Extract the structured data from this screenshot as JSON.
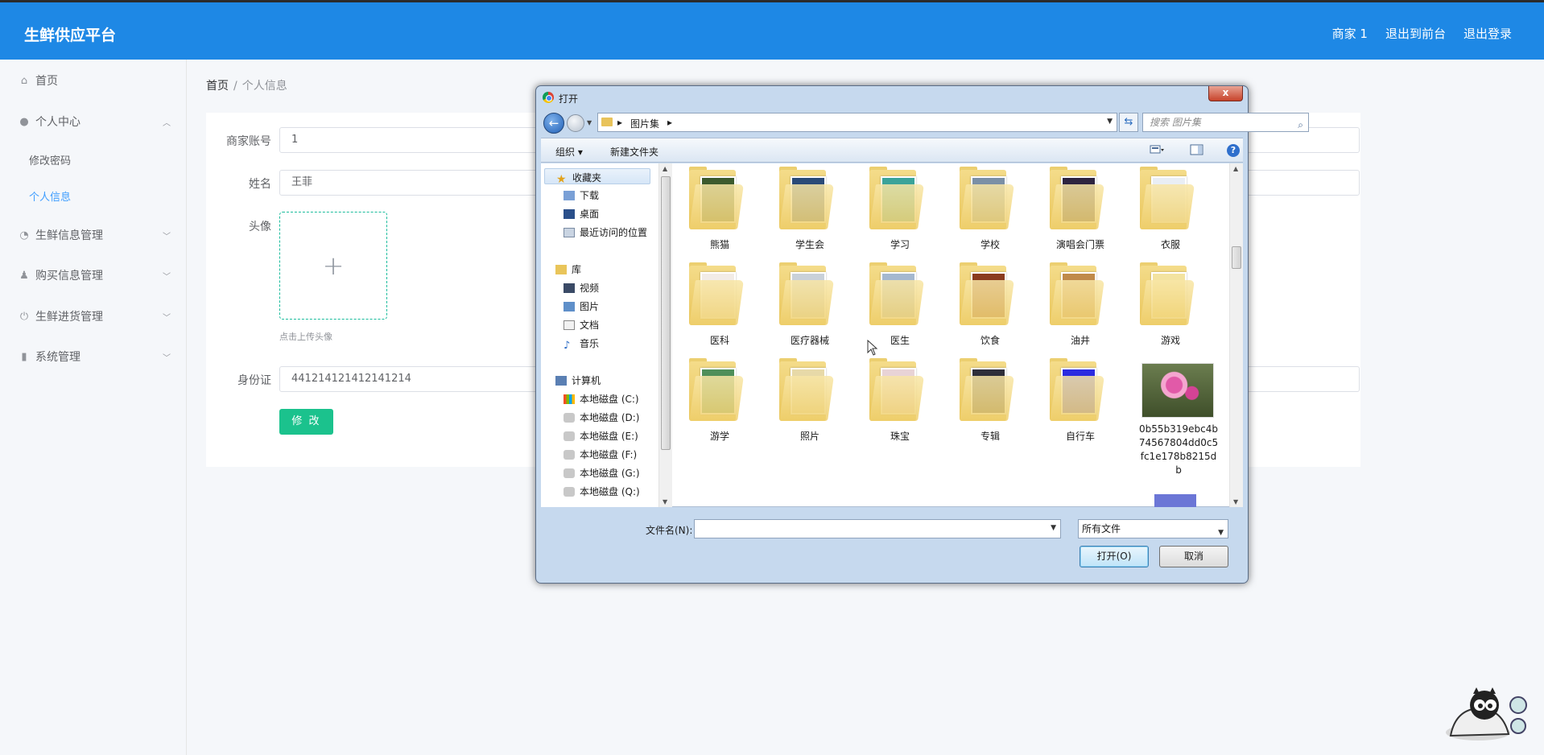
{
  "header": {
    "brand": "生鲜供应平台",
    "nav": [
      "商家 1",
      "退出到前台",
      "退出登录"
    ]
  },
  "sidebar": {
    "home": "首页",
    "personal_center": "个人中心",
    "change_password": "修改密码",
    "personal_info": "个人信息",
    "fresh_info": "生鲜信息管理",
    "purchase_info": "购买信息管理",
    "stock_in": "生鲜进货管理",
    "system": "系统管理"
  },
  "breadcrumb": {
    "home": "首页",
    "separator": "/",
    "current": "个人信息"
  },
  "form": {
    "account_label": "商家账号",
    "account_value": "1",
    "name_label": "姓名",
    "name_value": "王菲",
    "avatar_label": "头像",
    "avatar_plus": "+",
    "upload_tip": "点击上传头像",
    "id_label": "身份证",
    "id_value": "441214121412141214",
    "submit_label": "修 改"
  },
  "dialog": {
    "title": "打开",
    "close": "x",
    "back_arrow": "←",
    "address_root": "▸",
    "address_folder": "图片集",
    "address_arrow": "▸",
    "search_placeholder": "搜索 图片集",
    "toolbar": {
      "organize": "组织 ▾",
      "new_folder": "新建文件夹",
      "help": "?"
    },
    "nav_tree": {
      "favorites": "收藏夹",
      "downloads": "下载",
      "desktop": "桌面",
      "recent": "最近访问的位置",
      "library": "库",
      "videos": "视频",
      "pictures": "图片",
      "documents": "文档",
      "music": "音乐",
      "computer": "计算机",
      "drives": [
        "本地磁盘 (C:)",
        "本地磁盘 (D:)",
        "本地磁盘 (E:)",
        "本地磁盘 (F:)",
        "本地磁盘 (G:)",
        "本地磁盘 (Q:)"
      ]
    },
    "files": [
      {
        "name": "熊猫",
        "color": "#3c5a2e"
      },
      {
        "name": "学生会",
        "color": "#2a4a78"
      },
      {
        "name": "学习",
        "color": "#3aa39a"
      },
      {
        "name": "学校",
        "color": "#7a8fa6"
      },
      {
        "name": "演唱会门票",
        "color": "#2d2440"
      },
      {
        "name": "衣服",
        "color": "#e9eef5"
      },
      {
        "name": "医科",
        "color": "#f2ece6"
      },
      {
        "name": "医疗器械",
        "color": "#c9d1d9"
      },
      {
        "name": "医生",
        "color": "#a5b8cf"
      },
      {
        "name": "饮食",
        "color": "#8a3b1f"
      },
      {
        "name": "油井",
        "color": "#c08a4a"
      },
      {
        "name": "游戏",
        "color": "#f3e3a0"
      },
      {
        "name": "游学",
        "color": "#4e8f5a"
      },
      {
        "name": "照片",
        "color": "#e7d9a8"
      },
      {
        "name": "珠宝",
        "color": "#e8d3d6"
      },
      {
        "name": "专辑",
        "color": "#2e2e3a"
      },
      {
        "name": "自行车",
        "color": "#2b2be0"
      }
    ],
    "image_file": "0b55b319ebc4b74567804dd0c5fc1e178b8215db",
    "filename_label": "文件名(N):",
    "filetype": "所有文件",
    "open_button": "打开(O)",
    "cancel_button": "取消"
  }
}
